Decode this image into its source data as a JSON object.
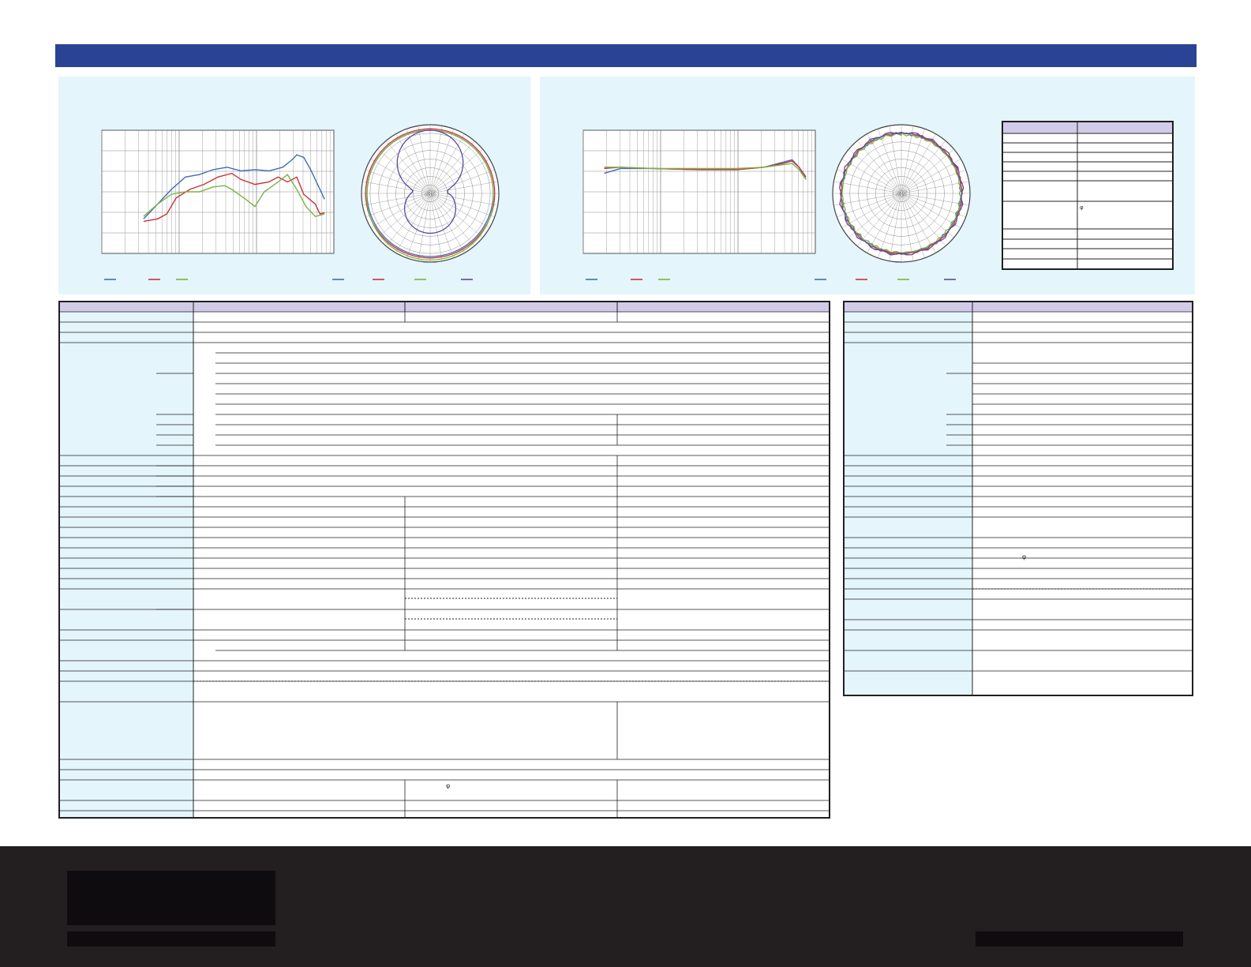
{
  "colors": {
    "header_bar": "#2b4395",
    "panel_bg": "#e4f5fc",
    "table_header": "#d1cbe8",
    "footer_bg": "#231f20",
    "series_blue": "#3f6db5",
    "series_red": "#c8323a",
    "series_green": "#7db343",
    "series_purple": "#5b4a9e",
    "grid": "#8a8a8a"
  },
  "left_panel": {
    "frequency_response": {
      "chart_data": {
        "type": "line",
        "title": "",
        "xlabel": "",
        "ylabel": "",
        "x_scale": "log",
        "grid": true,
        "series": [
          {
            "color": "blue",
            "values_shape": "rises from low, flat plateau, peak near high end, falls"
          },
          {
            "color": "red",
            "values_shape": "rises, plateau with mid-high bump, falls"
          },
          {
            "color": "green",
            "values_shape": "rises, dips mid-high, peak then falls"
          }
        ]
      },
      "legend_swatches": [
        "blue",
        "red",
        "green"
      ]
    },
    "polar_pattern": {
      "center_label": "-35",
      "legend_swatches": [
        "blue",
        "red",
        "green",
        "purple"
      ]
    }
  },
  "right_panel": {
    "frequency_response": {
      "chart_data": {
        "type": "line",
        "title": "",
        "xlabel": "",
        "ylabel": "",
        "x_scale": "log",
        "grid": true,
        "series": [
          {
            "color": "blue",
            "values_shape": "flat with slight rise near high end"
          },
          {
            "color": "red",
            "values_shape": "flat with slight rise near high end"
          },
          {
            "color": "green",
            "values_shape": "flat with slight rise near high end"
          }
        ]
      },
      "legend_swatches": [
        "blue",
        "red",
        "green"
      ]
    },
    "polar_pattern": {
      "center_label": "-35",
      "legend_swatches": [
        "blue",
        "red",
        "green",
        "purple"
      ]
    },
    "mini_table_symbol": "φ"
  },
  "spec_table_main": {
    "symbol": "φ"
  },
  "spec_table_side": {
    "symbol": "φ"
  }
}
